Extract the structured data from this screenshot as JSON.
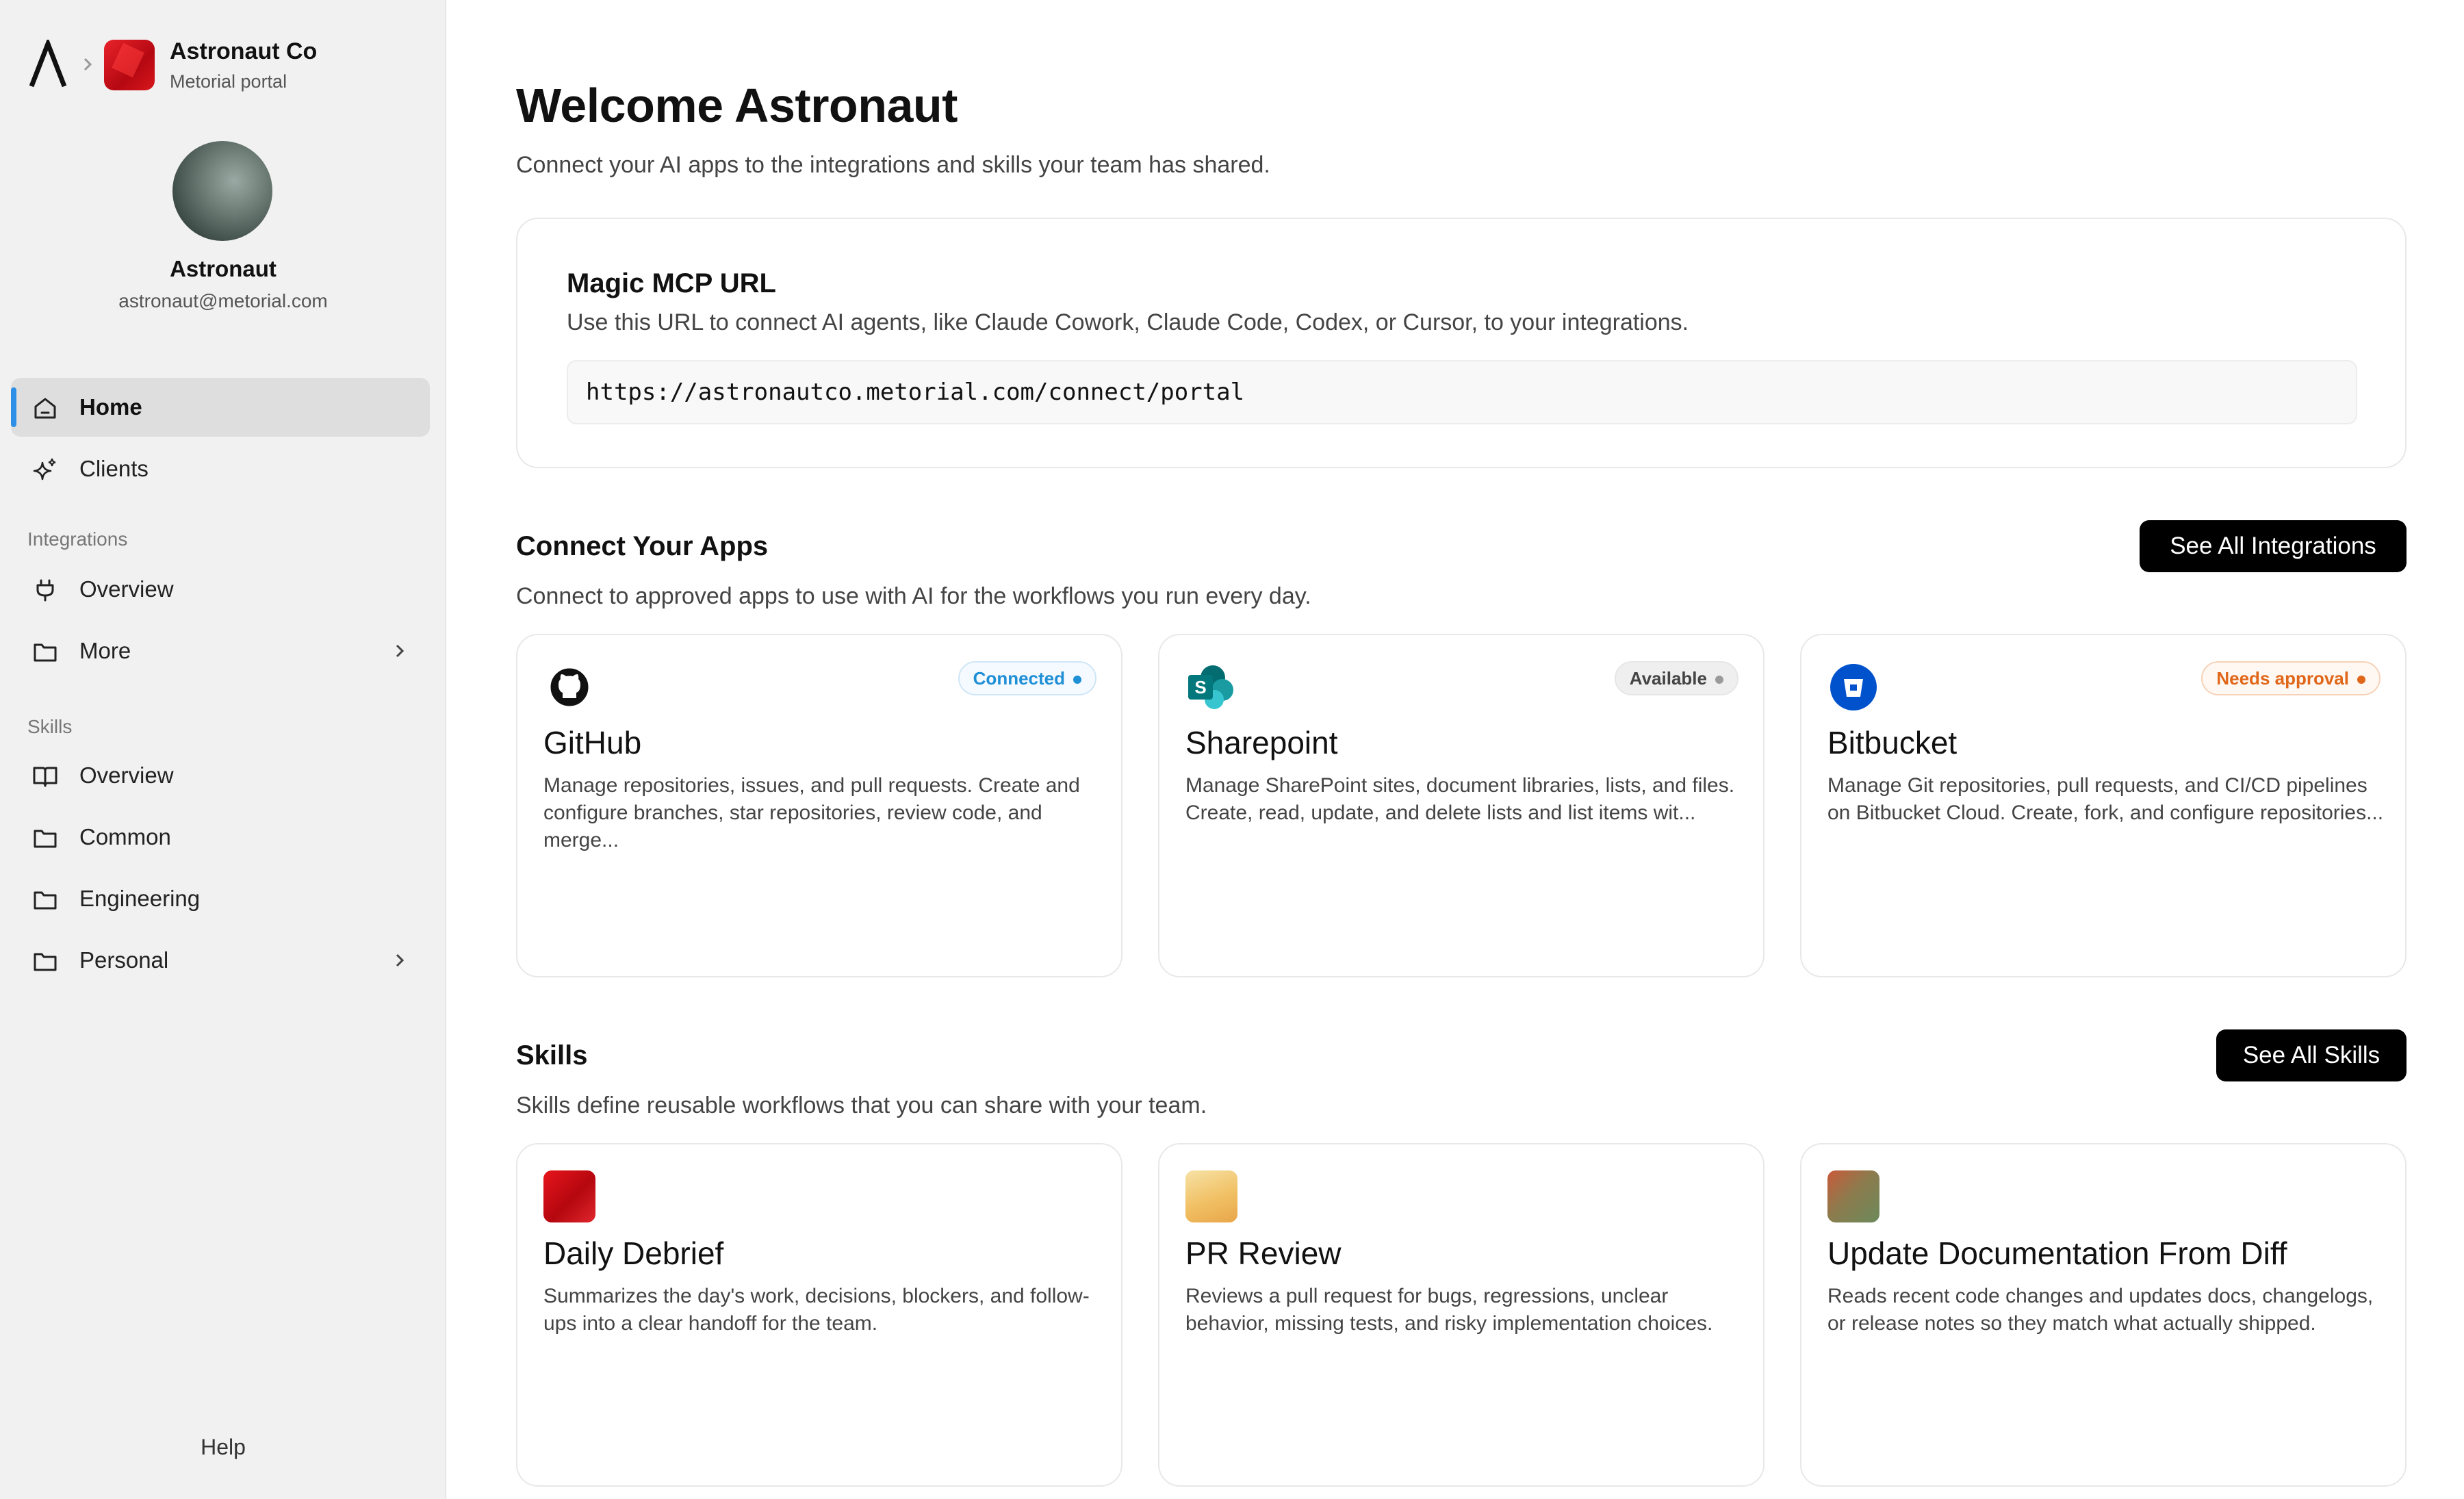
{
  "org": {
    "name": "Astronaut Co",
    "subtitle": "Metorial portal"
  },
  "user": {
    "name": "Astronaut",
    "email": "astronaut@metorial.com"
  },
  "sidebar": {
    "main_items": [
      {
        "label": "Home",
        "icon": "home-icon",
        "active": true
      },
      {
        "label": "Clients",
        "icon": "sparkle-icon"
      }
    ],
    "integrations_label": "Integrations",
    "integrations_items": [
      {
        "label": "Overview",
        "icon": "plug-icon"
      },
      {
        "label": "More",
        "icon": "folder-icon"
      }
    ],
    "skills_label": "Skills",
    "skills_items": [
      {
        "label": "Overview",
        "icon": "book-icon"
      },
      {
        "label": "Common",
        "icon": "folder-icon"
      },
      {
        "label": "Engineering",
        "icon": "folder-icon"
      },
      {
        "label": "Personal",
        "icon": "folder-icon"
      }
    ],
    "help_label": "Help"
  },
  "main": {
    "title": "Welcome Astronaut",
    "subtitle": "Connect your AI apps to the integrations and skills your team has shared.",
    "mcp": {
      "title": "Magic MCP URL",
      "description": "Use this URL to connect AI agents, like Claude Cowork, Claude Code, Codex, or Cursor, to your integrations.",
      "url": "https://astronautco.metorial.com/connect/portal"
    },
    "apps": {
      "title": "Connect Your Apps",
      "description": "Connect to approved apps to use with AI for the workflows you run every day.",
      "button": "See All Integrations",
      "cards": [
        {
          "name": "GitHub",
          "status": "Connected",
          "description": "Manage repositories, issues, and pull requests. Create and configure branches, star repositories, review code, and merge...",
          "icon": "github-icon"
        },
        {
          "name": "Sharepoint",
          "status": "Available",
          "description": "Manage SharePoint sites, document libraries, lists, and files. Create, read, update, and delete lists and list items wit...",
          "icon": "sharepoint-icon"
        },
        {
          "name": "Bitbucket",
          "status": "Needs approval",
          "description": "Manage Git repositories, pull requests, and CI/CD pipelines on Bitbucket Cloud. Create, fork, and configure repositories...",
          "icon": "bitbucket-icon"
        }
      ]
    },
    "skills": {
      "title": "Skills",
      "description": "Skills define reusable workflows that you can share with your team.",
      "button": "See All Skills",
      "cards": [
        {
          "name": "Daily Debrief",
          "description": "Summarizes the day's work, decisions, blockers, and follow-ups into a clear handoff for the team."
        },
        {
          "name": "PR Review",
          "description": "Reviews a pull request for bugs, regressions, unclear behavior, missing tests, and risky implementation choices."
        },
        {
          "name": "Update Documentation From Diff",
          "description": "Reads recent code changes and updates docs, changelogs, or release notes so they match what actually shipped."
        }
      ]
    }
  },
  "colors": {
    "accent": "#2e8fe6",
    "connected": "#1f8fd6",
    "needs_approval": "#e0671a",
    "button": "#000000"
  }
}
